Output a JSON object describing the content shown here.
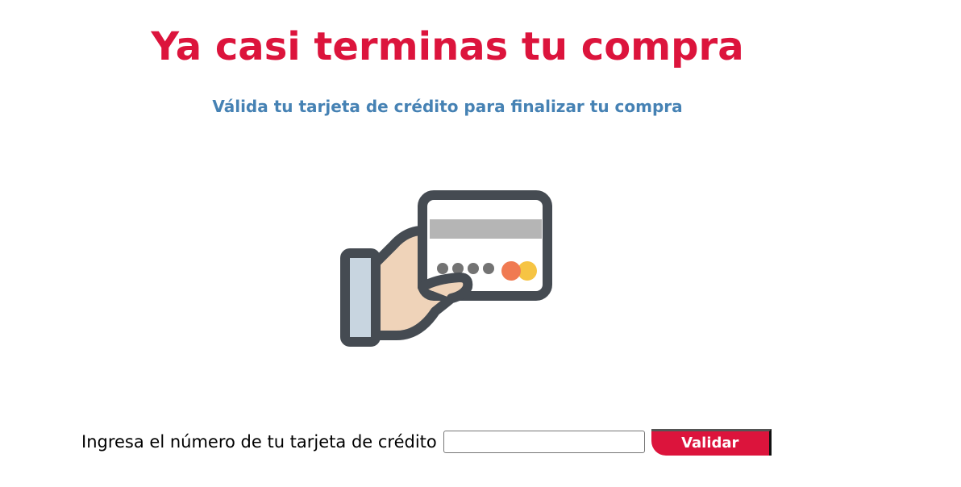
{
  "header": {
    "title": "Ya casi terminas tu compra",
    "subtitle": "Válida tu tarjeta de crédito para finalizar tu compra"
  },
  "illustration": {
    "icon": "hand-holding-credit-card-icon"
  },
  "form": {
    "label": "Ingresa el número de tu tarjeta de crédito",
    "input_value": "",
    "button_label": "Validar"
  },
  "colors": {
    "title": "#dc143c",
    "subtitle": "#4682b4",
    "button": "#dc143c"
  }
}
